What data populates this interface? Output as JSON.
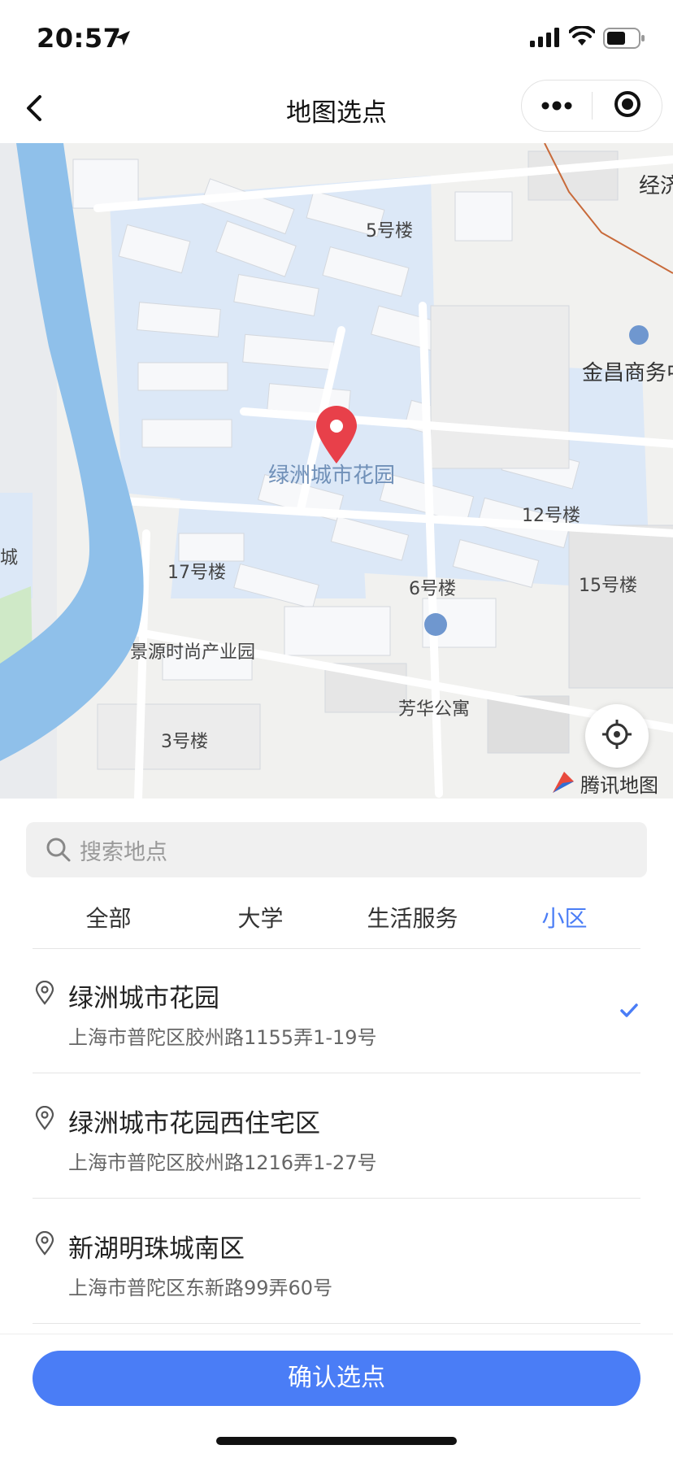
{
  "status_bar": {
    "time": "20:57",
    "icons": [
      "location-arrow-icon",
      "signal-icon",
      "wifi-icon",
      "battery-icon"
    ]
  },
  "nav": {
    "title": "地图选点",
    "icons": [
      "back-icon",
      "more-icon",
      "close-mini-program-icon"
    ]
  },
  "map": {
    "selected_place": "绿洲城市花园",
    "labels": {
      "building_5": "5号楼",
      "economy_partial": "经济",
      "jinchang": "金昌商务中",
      "building_12": "12号楼",
      "building_17": "17号楼",
      "building_6": "6号楼",
      "building_15": "15号楼",
      "jingyuan": "景源时尚产业园",
      "fanghua": "芳华公寓",
      "building_3": "3号楼",
      "left_edge": "城"
    },
    "provider": "腾讯地图",
    "colors": {
      "water": "#8fc0ea",
      "residential": "#dce8f7",
      "pin": "#e8404a"
    }
  },
  "search": {
    "placeholder": "搜索地点"
  },
  "tabs": [
    {
      "label": "全部",
      "active": false
    },
    {
      "label": "大学",
      "active": false
    },
    {
      "label": "生活服务",
      "active": false
    },
    {
      "label": "小区",
      "active": true
    }
  ],
  "results": [
    {
      "name": "绿洲城市花园",
      "address": "上海市普陀区胶州路1155弄1-19号",
      "selected": true
    },
    {
      "name": "绿洲城市花园西住宅区",
      "address": "上海市普陀区胶州路1216弄1-27号",
      "selected": false
    },
    {
      "name": "新湖明珠城南区",
      "address": "上海市普陀区东新路99弄60号",
      "selected": false
    }
  ],
  "confirm": {
    "label": "确认选点"
  },
  "accent_color": "#4a7df6"
}
